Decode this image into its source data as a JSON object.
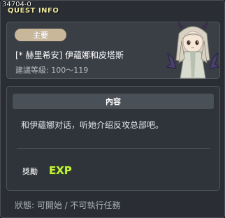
{
  "window": {
    "id": "34704-0",
    "title": "QUEST INFO"
  },
  "quest": {
    "category": "主要",
    "title": "[* 赫里希安] 伊蘊娜和皮塔斯",
    "level_range": "建議等級: 100～119",
    "npc_icon": "npc-portrait-icon"
  },
  "content": {
    "header": "內容",
    "description": "和伊蘊娜对话，听她介绍反攻总部吧。",
    "reward_label": "獎勵",
    "reward_icon": "exp-icon",
    "reward_text": "EXP"
  },
  "status": {
    "text": "狀態: 可開始 / 不可執行任務"
  },
  "colors": {
    "badge": "#c9b79a",
    "title": "#f0e8a0",
    "exp_fill": "#c8f03c",
    "exp_outline": "#2a5a10"
  }
}
